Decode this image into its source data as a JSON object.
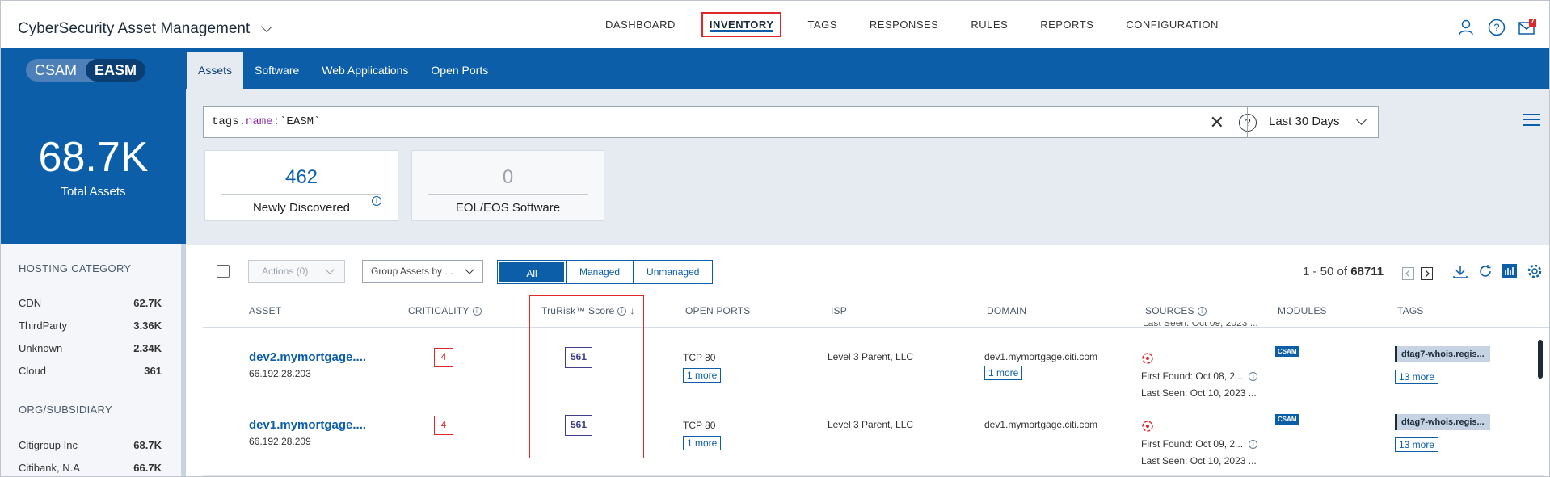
{
  "app": {
    "title": "CyberSecurity Asset Management"
  },
  "nav": [
    {
      "label": "DASHBOARD",
      "active": false
    },
    {
      "label": "INVENTORY",
      "active": true
    },
    {
      "label": "TAGS",
      "active": false
    },
    {
      "label": "RESPONSES",
      "active": false
    },
    {
      "label": "RULES",
      "active": false
    },
    {
      "label": "REPORTS",
      "active": false
    },
    {
      "label": "CONFIGURATION",
      "active": false
    }
  ],
  "notifications": {
    "count": "7"
  },
  "toggle": {
    "csam": "CSAM",
    "easm": "EASM"
  },
  "subtabs": [
    {
      "label": "Assets",
      "active": true
    },
    {
      "label": "Software",
      "active": false
    },
    {
      "label": "Web Applications",
      "active": false
    },
    {
      "label": "Open Ports",
      "active": false
    }
  ],
  "summary": {
    "total": "68.7K",
    "total_label": "Total Assets"
  },
  "hosting": {
    "title": "HOSTING CATEGORY",
    "items": [
      {
        "label": "CDN",
        "value": "62.7K"
      },
      {
        "label": "ThirdParty",
        "value": "3.36K"
      },
      {
        "label": "Unknown",
        "value": "2.34K"
      },
      {
        "label": "Cloud",
        "value": "361"
      }
    ]
  },
  "org": {
    "title": "ORG/SUBSIDIARY",
    "items": [
      {
        "label": "Citigroup Inc",
        "value": "68.7K"
      },
      {
        "label": "Citibank, N.A",
        "value": "66.7K"
      }
    ]
  },
  "search": {
    "query_key": "tags.",
    "query_field": "name",
    "query_rest": ":`EASM`",
    "range": "Last 30 Days"
  },
  "cards": [
    {
      "value": "462",
      "label": "Newly Discovered"
    },
    {
      "value": "0",
      "label": "EOL/EOS Software"
    }
  ],
  "toolbar": {
    "actions": "Actions (0)",
    "groupby": "Group Assets by ...",
    "filters": [
      "All",
      "Managed",
      "Unmanaged"
    ],
    "range_text": "1 - 50 of",
    "total": "68711"
  },
  "columns": {
    "asset": "ASSET",
    "criticality": "CRITICALITY",
    "trurisk": "TruRisk™ Score",
    "ports": "OPEN PORTS",
    "isp": "ISP",
    "domain": "DOMAIN",
    "sources": "SOURCES",
    "modules": "MODULES",
    "tags": "TAGS"
  },
  "ghost_row": "Last Seen: Oct 09, 2023 ...",
  "rows": [
    {
      "asset": "dev2.mymortgage....",
      "ip": "66.192.28.203",
      "criticality": "4",
      "trurisk": "561",
      "port": "TCP 80",
      "port_more": "1 more",
      "isp": "Level 3 Parent, LLC",
      "domain": "dev1.mymortgage.citi.com",
      "domain_more": "1 more",
      "first_found": "First Found: Oct 08, 2...",
      "last_seen": "Last Seen: Oct 10, 2023 ...",
      "module": "CSAM",
      "tag": "dtag7-whois.regis...",
      "tag_more": "13 more"
    },
    {
      "asset": "dev1.mymortgage....",
      "ip": "66.192.28.209",
      "criticality": "4",
      "trurisk": "561",
      "port": "TCP 80",
      "port_more": "1 more",
      "isp": "Level 3 Parent, LLC",
      "domain": "dev1.mymortgage.citi.com",
      "domain_more": "",
      "first_found": "First Found: Oct 09, 2...",
      "last_seen": "Last Seen: Oct 10, 2023 ...",
      "module": "CSAM",
      "tag": "dtag7-whois.regis...",
      "tag_more": "13 more"
    }
  ],
  "colors": {
    "brand": "#0c5ea8",
    "highlight": "#e0282a",
    "score": "#3d3d8a"
  },
  "icons": [
    "chevron-down-icon",
    "user-icon",
    "help-icon",
    "mail-icon",
    "close-icon",
    "menu-icon",
    "download-icon",
    "refresh-icon",
    "chart-icon",
    "gear-icon",
    "info-icon",
    "sort-down-icon",
    "source-icon"
  ]
}
